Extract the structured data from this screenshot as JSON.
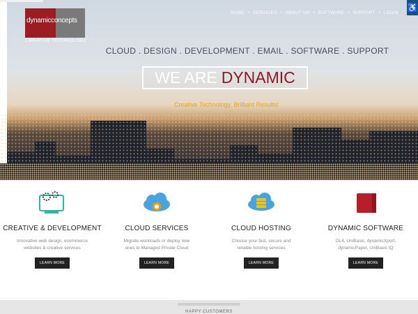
{
  "logo": {
    "name": "dynamicconcepts",
    "tagline": "CREATIVE TECHNOLOGY"
  },
  "nav": {
    "items": [
      "HOME",
      "SERVICES",
      "ABOUT US",
      "SOFTWARE",
      "SUPPORT",
      "LOGIN"
    ]
  },
  "accessibility_icon": "wheelchair-icon",
  "hero": {
    "tagline": "CLOUD . DESIGN . DEVELOPMENT . EMAIL . SOFTWARE . SUPPORT",
    "headline_part1": "WE ARE",
    "headline_part2": "DYNAMIC",
    "subline": "Creative Technology, Brilliant Results!"
  },
  "colors": {
    "brand_red": "#9b1c23",
    "accent_gold": "#e0a419",
    "nav_blue": "#1a4f83"
  },
  "features": [
    {
      "icon": "monitor-gears-icon",
      "title": "CREATIVE & DEVELOPMENT",
      "desc1": "Innovative web design, ecommerce",
      "desc2": "websites & creative services",
      "button": "LEARN MORE"
    },
    {
      "icon": "cloud-gear-icon",
      "title": "CLOUD SERVICES",
      "desc1": "Migrate workloads or deploy new",
      "desc2": "ones to Managed Private Cloud",
      "button": "LEARN MORE"
    },
    {
      "icon": "cloud-server-icon",
      "title": "CLOUD HOSTING",
      "desc1": "Choose your fast, secure and",
      "desc2": "reliable hosting services",
      "button": "LEARN MORE"
    },
    {
      "icon": "red-square-icon",
      "title": "DYNAMIC SOFTWARE",
      "desc1": "DL4, UniBasic, dynamicXport,",
      "desc2": "dynamicPaper, UniBasic IQ",
      "button": "LEARN MORE"
    }
  ],
  "bottom": {
    "text": "HAPPY CUSTOMERS"
  }
}
